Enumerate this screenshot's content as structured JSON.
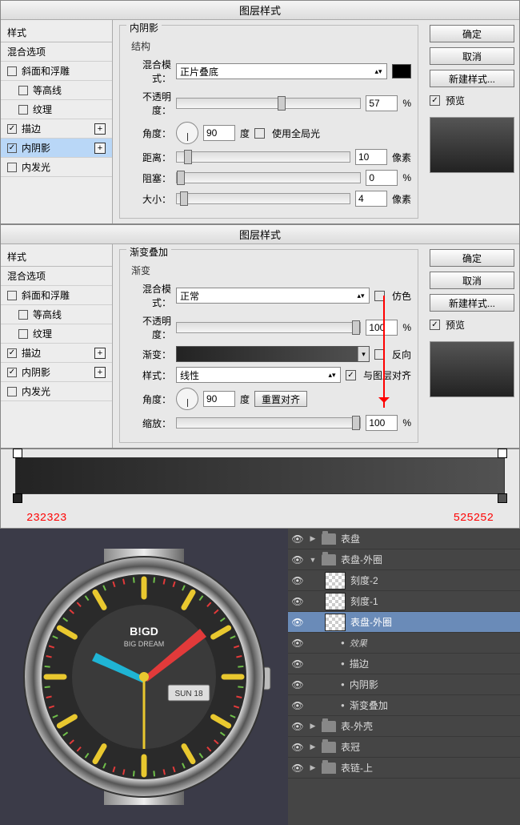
{
  "dialog1": {
    "title": "图层样式",
    "sidebar": {
      "header": "样式",
      "blend_header": "混合选项",
      "items": [
        {
          "label": "斜面和浮雕",
          "checked": false,
          "plus": false
        },
        {
          "label": "等高线",
          "checked": false,
          "plus": false,
          "indent": true
        },
        {
          "label": "纹理",
          "checked": false,
          "plus": false,
          "indent": true
        },
        {
          "label": "描边",
          "checked": true,
          "plus": true
        },
        {
          "label": "内阴影",
          "checked": true,
          "plus": true,
          "selected": true
        },
        {
          "label": "内发光",
          "checked": false,
          "plus": false
        }
      ]
    },
    "section_title": "内阴影",
    "subsection": "结构",
    "blend_mode_label": "混合模式：",
    "blend_mode_value": "正片叠底",
    "opacity_label": "不透明度：",
    "opacity_value": "57",
    "opacity_unit": "%",
    "angle_label": "角度：",
    "angle_value": "90",
    "angle_unit": "度",
    "global_light": "使用全局光",
    "distance_label": "距离：",
    "distance_value": "10",
    "px": "像素",
    "choke_label": "阻塞：",
    "choke_value": "0",
    "choke_unit": "%",
    "size_label": "大小：",
    "size_value": "4",
    "buttons": {
      "ok": "确定",
      "cancel": "取消",
      "new": "新建样式...",
      "preview": "预览"
    }
  },
  "dialog2": {
    "title": "图层样式",
    "sidebar": {
      "header": "样式",
      "blend_header": "混合选项",
      "items": [
        {
          "label": "斜面和浮雕",
          "checked": false
        },
        {
          "label": "等高线",
          "checked": false,
          "indent": true
        },
        {
          "label": "纹理",
          "checked": false,
          "indent": true
        },
        {
          "label": "描边",
          "checked": true,
          "plus": true
        },
        {
          "label": "内阴影",
          "checked": true,
          "plus": true
        },
        {
          "label": "内发光",
          "checked": false
        }
      ]
    },
    "section_title": "渐变叠加",
    "subsection": "渐变",
    "blend_mode_label": "混合模式：",
    "blend_mode_value": "正常",
    "dither": "仿色",
    "opacity_label": "不透明度：",
    "opacity_value": "100",
    "opacity_unit": "%",
    "gradient_label": "渐变：",
    "reverse": "反向",
    "style_label": "样式：",
    "style_value": "线性",
    "align": "与图层对齐",
    "angle_label": "角度：",
    "angle_value": "90",
    "angle_unit": "度",
    "reset_align": "重置对齐",
    "scale_label": "缩放：",
    "scale_value": "100",
    "scale_unit": "%",
    "buttons": {
      "ok": "确定",
      "cancel": "取消",
      "new": "新建样式...",
      "preview": "预览"
    }
  },
  "gradient": {
    "left_hex": "232323",
    "right_hex": "525252"
  },
  "watch": {
    "brand_top": "B!GD",
    "brand_bottom": "BIG DREAM",
    "date": "SUN 18"
  },
  "layers": [
    {
      "vis": true,
      "type": "folder",
      "label": "表盘",
      "twist": "▶",
      "depth": 0
    },
    {
      "vis": true,
      "type": "folder",
      "label": "表盘-外圈",
      "twist": "▼",
      "depth": 0,
      "open": true
    },
    {
      "vis": true,
      "type": "layer",
      "label": "刻度-2",
      "depth": 1
    },
    {
      "vis": true,
      "type": "layer",
      "label": "刻度-1",
      "depth": 1
    },
    {
      "vis": true,
      "type": "layer",
      "label": "表盘-外圈",
      "depth": 1,
      "selected": true
    },
    {
      "vis": true,
      "type": "fx-head",
      "label": "效果",
      "depth": 2
    },
    {
      "vis": true,
      "type": "fx",
      "label": "描边",
      "depth": 2
    },
    {
      "vis": true,
      "type": "fx",
      "label": "内阴影",
      "depth": 2
    },
    {
      "vis": true,
      "type": "fx",
      "label": "渐变叠加",
      "depth": 2
    },
    {
      "vis": true,
      "type": "folder",
      "label": "表-外壳",
      "twist": "▶",
      "depth": 0
    },
    {
      "vis": true,
      "type": "folder",
      "label": "表冠",
      "twist": "▶",
      "depth": 0
    },
    {
      "vis": true,
      "type": "folder",
      "label": "表链-上",
      "twist": "▶",
      "depth": 0
    }
  ]
}
